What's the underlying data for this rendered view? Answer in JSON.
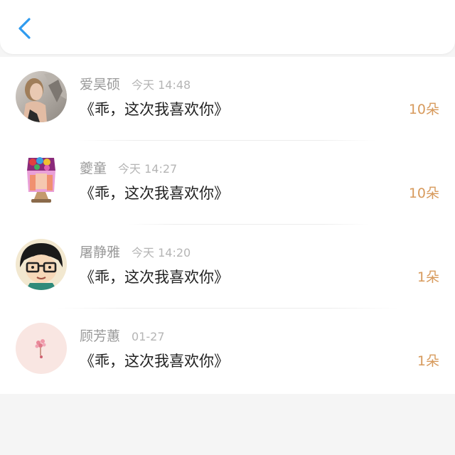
{
  "header": {
    "back_icon": "chevron-left-icon",
    "accent_color": "#2f9bef"
  },
  "gift_records": [
    {
      "name": "爱昊硕",
      "time": "今天 14:48",
      "gift": "《乖，这次我喜欢你》",
      "count": "10朵",
      "avatar": "avatar-photo-woman"
    },
    {
      "name": "夔童",
      "time": "今天 14:27",
      "gift": "《乖，这次我喜欢你》",
      "count": "10朵",
      "avatar": "avatar-cartoon-colorful"
    },
    {
      "name": "屠静雅",
      "time": "今天 14:20",
      "gift": "《乖，这次我喜欢你》",
      "count": "1朵",
      "avatar": "avatar-cartoon-glasses"
    },
    {
      "name": "顾芳蕙",
      "time": "01-27",
      "gift": "《乖，这次我喜欢你》",
      "count": "1朵",
      "avatar": "avatar-flower-pink"
    }
  ],
  "colors": {
    "name": "#9a9a9a",
    "time": "#b5b5b5",
    "gift_text": "#222222",
    "count": "#d79a5c",
    "background": "#f5f5f5"
  }
}
